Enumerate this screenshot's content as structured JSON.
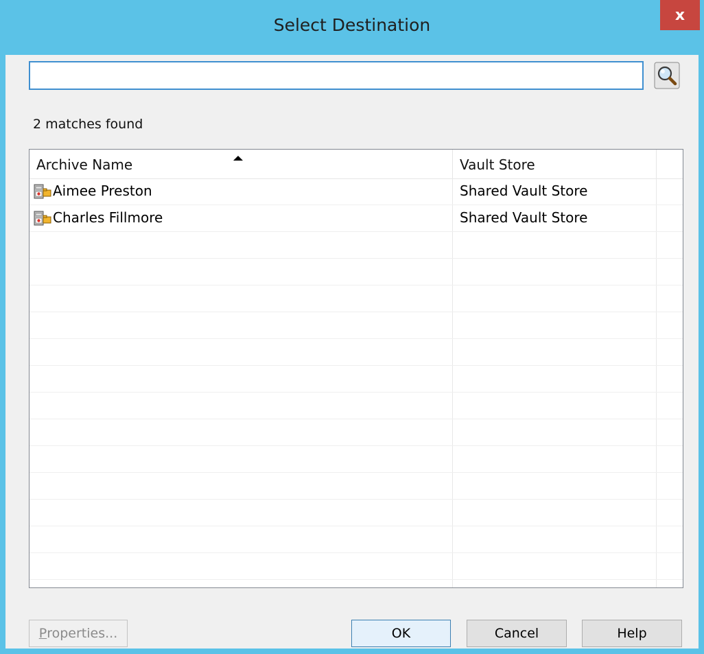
{
  "window": {
    "title": "Select Destination",
    "close_label": "x"
  },
  "search": {
    "value": "",
    "placeholder": ""
  },
  "status": {
    "match_count": "2 matches found"
  },
  "list": {
    "columns": [
      "Archive Name",
      "Vault Store"
    ],
    "sort_column": "Archive Name",
    "sort_direction": "ascending",
    "rows": [
      {
        "archive_name": "Aimee Preston",
        "vault_store": "Shared Vault Store",
        "icon": "archive-icon"
      },
      {
        "archive_name": "Charles Fillmore",
        "vault_store": "Shared Vault Store",
        "icon": "archive-icon"
      }
    ]
  },
  "buttons": {
    "properties_first": "P",
    "properties_rest": "roperties...",
    "ok": "OK",
    "cancel": "Cancel",
    "help": "Help"
  },
  "colors": {
    "frame": "#5bc2e7",
    "close": "#c7463f",
    "focus_border": "#3f8fd0"
  }
}
